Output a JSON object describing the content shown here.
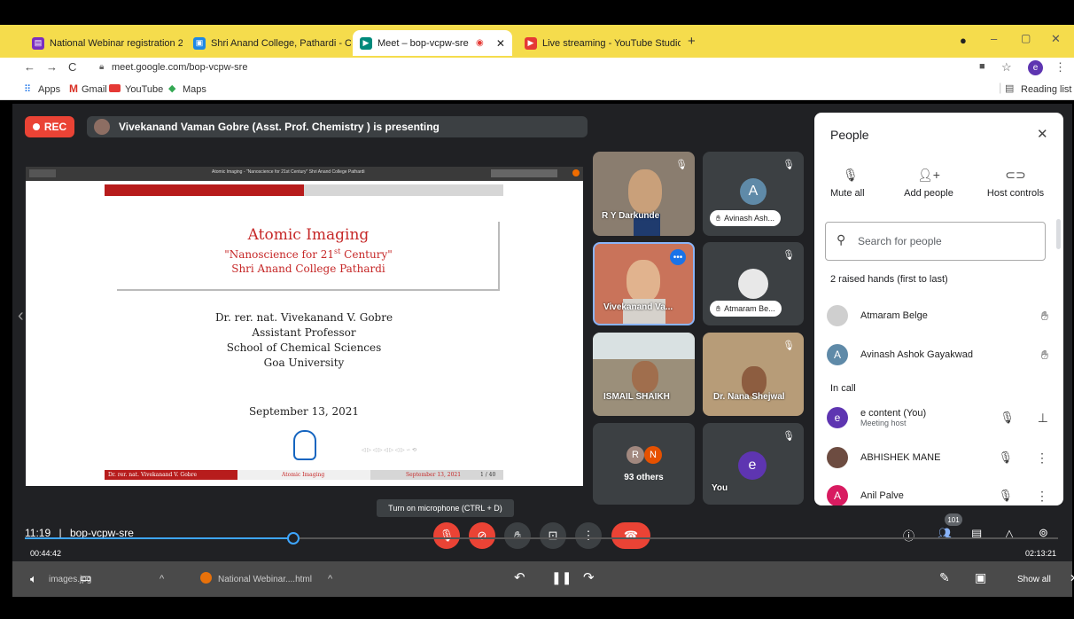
{
  "browser": {
    "tabs": [
      {
        "title": "National Webinar registration 20"
      },
      {
        "title": "Shri Anand College, Pathardi - C"
      },
      {
        "title": "Meet – bop-vcpw-sre"
      },
      {
        "title": "Live streaming - YouTube Studio"
      }
    ],
    "url": "meet.google.com/bop-vcpw-sre",
    "profile_initial": "e",
    "bookmarks": [
      "Apps",
      "Gmail",
      "YouTube",
      "Maps"
    ],
    "reading_list": "Reading list"
  },
  "meet": {
    "rec_label": "REC",
    "presenting_text": "Vivekanand Vaman Gobre (Asst. Prof. Chemistry ) is presenting",
    "slide": {
      "viewer_title": "Atomic Imaging - \"Nanoscience for 21st Century\"  Shri Anand College Pathardi",
      "title": "Atomic Imaging",
      "subtitle_1": "\"Nanoscience for 21",
      "subtitle_sup": "st",
      "subtitle_2": " Century\"",
      "college": "Shri Anand College Pathardi",
      "author": "Dr. rer. nat. Vivekanand V. Gobre",
      "position": "Assistant Professor",
      "school": "School of Chemical Sciences",
      "university": "Goa University",
      "date": "September 13, 2021",
      "footer_author": "Dr. rer. nat. Vivekanand V. Gobre",
      "footer_title": "Atomic Imaging",
      "footer_date": "September 13, 2021",
      "footer_page": "1 / 40"
    },
    "tiles": {
      "t1_name": "R Y Darkunde",
      "t2_initial": "A",
      "t2_chip": "Avinash Ash...",
      "t3_name": "Vivekanand Va...",
      "t4_chip": "Atmaram Be...",
      "t5_name": "ISMAIL SHAIKH",
      "t6_name": "Dr. Nana Shejwal",
      "t7_a": "R",
      "t7_b": "N",
      "t7_label": "93 others",
      "t8_initial": "e",
      "t8_label": "You"
    },
    "tooltip": "Turn on microphone (CTRL + D)",
    "meeting_time": "11:19",
    "meeting_code": "bop-vcpw-sre",
    "participant_count": "101"
  },
  "people": {
    "title": "People",
    "actions": [
      "Mute all",
      "Add people",
      "Host controls"
    ],
    "search_placeholder": "Search for people",
    "raised_heading": "2 raised hands (first to last)",
    "raised": [
      {
        "name": "Atmaram Belge"
      },
      {
        "name": "Avinash Ashok Gayakwad",
        "initial": "A"
      }
    ],
    "incall_heading": "In call",
    "incall": [
      {
        "name": "e content (You)",
        "sub": "Meeting host",
        "initial": "e"
      },
      {
        "name": "ABHISHEK MANE"
      },
      {
        "name": "Anil Palve",
        "initial": "A"
      }
    ]
  },
  "player": {
    "elapsed": "00:44:42",
    "total": "02:13:21",
    "progress_fraction": 0.26
  },
  "taskbar": {
    "item1": "images.jpg",
    "item2": "National Webinar....html",
    "show_all": "Show all"
  },
  "colors": {
    "tabbar": "#f5dc4c",
    "meet_bg": "#202124",
    "red": "#ea4335",
    "accent": "#1a73e8"
  }
}
